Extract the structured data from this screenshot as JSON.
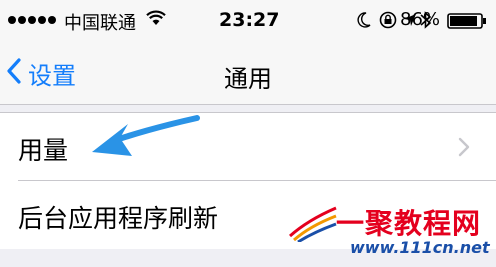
{
  "status_bar": {
    "carrier": "中国联通",
    "time": "23:27",
    "battery_percent": "86%",
    "icons": [
      "signal-dots",
      "wifi-icon",
      "moon-icon",
      "rotation-lock-icon",
      "location-arrow-icon",
      "bluetooth-icon",
      "battery-icon"
    ]
  },
  "nav": {
    "back_label": "设置",
    "title": "通用"
  },
  "list": {
    "items": [
      {
        "label": "用量"
      },
      {
        "label": "后台应用程序刷新"
      }
    ]
  },
  "watermark": {
    "brand": "一聚教程网",
    "url": "www.111cn.net"
  },
  "colors": {
    "accent": "#147efb",
    "annotation_arrow": "#2a93e6",
    "watermark_red": "#e4001e",
    "watermark_blue": "#1a4fa8"
  }
}
